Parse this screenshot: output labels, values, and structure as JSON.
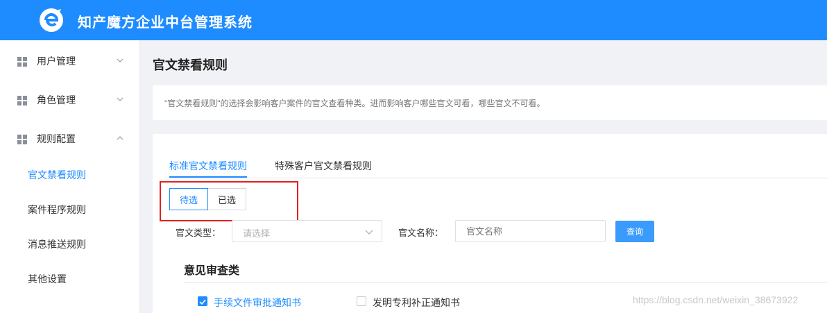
{
  "header": {
    "app_title": "知产魔方企业中台管理系统",
    "logo_icon": "e-logo-icon",
    "bg_color": "#1e8cff"
  },
  "sidebar": {
    "groups": [
      {
        "label": "用户管理",
        "icon": "grid-icon",
        "expanded": false
      },
      {
        "label": "角色管理",
        "icon": "grid-icon",
        "expanded": false
      },
      {
        "label": "规则配置",
        "icon": "grid-icon",
        "expanded": true
      }
    ],
    "sub_items": [
      {
        "label": "官文禁看规则",
        "active": true
      },
      {
        "label": "案件程序规则",
        "active": false
      },
      {
        "label": "消息推送规则",
        "active": false
      },
      {
        "label": "其他设置",
        "active": false
      }
    ]
  },
  "page": {
    "title": "官文禁看规则",
    "notice": "\"官文禁看规则\"的选择会影响客户案件的官文查看种类。进而影响客户哪些官文可看，哪些官文不可看。"
  },
  "tabs": [
    {
      "label": "标准官文禁看规则",
      "active": true
    },
    {
      "label": "特殊客户官文禁看规则",
      "active": false
    }
  ],
  "segment": {
    "pending_label": "待选",
    "selected_label": "已选",
    "active": "待选"
  },
  "filters": {
    "type_label": "官文类型：",
    "type_placeholder": "请选择",
    "name_label": "官文名称：",
    "name_placeholder": "官文名称",
    "query_label": "查询"
  },
  "section": {
    "title": "意见审查类",
    "items": [
      {
        "label": "手续文件审批通知书",
        "checked": true
      },
      {
        "label": "发明专利补正通知书",
        "checked": false
      }
    ]
  },
  "watermark": "https://blog.csdn.net/weixin_38673922",
  "colors": {
    "accent": "#1e8cff",
    "highlight_border": "#e02020"
  }
}
